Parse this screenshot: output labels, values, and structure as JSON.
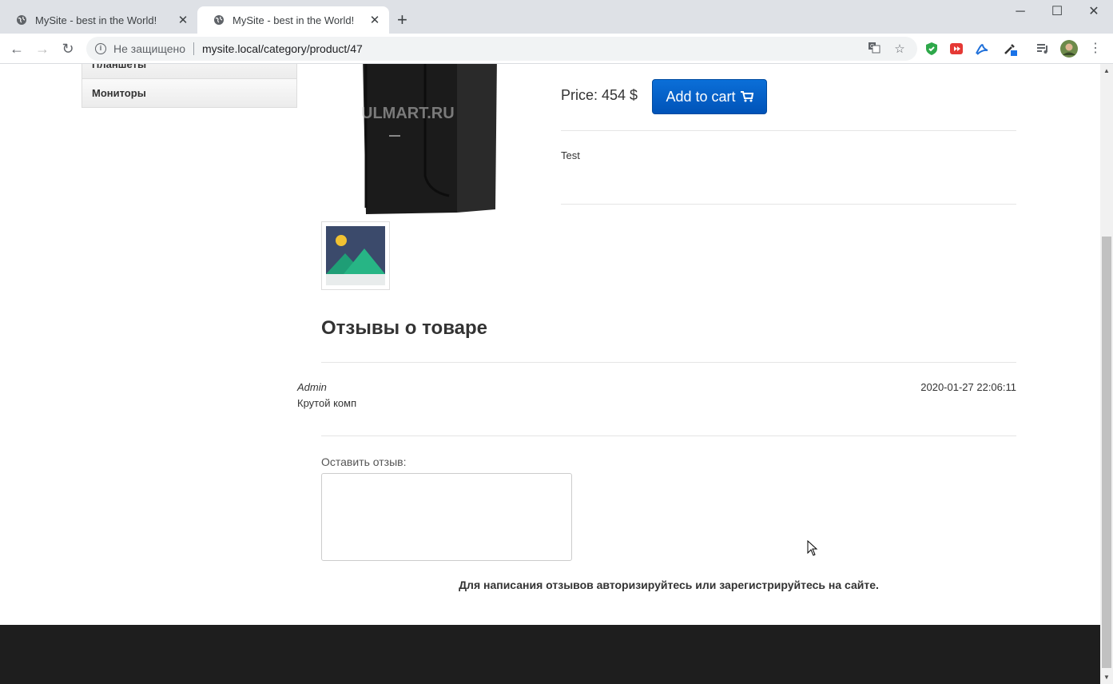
{
  "browser": {
    "tabs": [
      {
        "title": "MySite - best in the World!",
        "close": "✕"
      },
      {
        "title": "MySite - best in the World!",
        "close": "✕"
      }
    ],
    "new_tab": "+",
    "window_controls": {
      "minimize": "─",
      "maximize": "☐",
      "close": "✕"
    },
    "nav": {
      "back": "←",
      "forward": "→",
      "reload": "↻"
    },
    "address": {
      "security_text": "Не защищено",
      "url": "mysite.local/category/product/47"
    },
    "menu": "⋮"
  },
  "sidebar": {
    "items": [
      {
        "label": "Планшеты"
      },
      {
        "label": "Мониторы"
      }
    ]
  },
  "product": {
    "watermark": "ULMART.RU",
    "price": "Price: 454 $",
    "add_to_cart": "Add to cart",
    "description": "Test"
  },
  "reviews": {
    "title": "Отзывы о товаре",
    "items": [
      {
        "author": "Admin",
        "date": "2020-01-27 22:06:11",
        "text": "Крутой комп"
      }
    ],
    "form_label": "Оставить отзыв:",
    "auth_message": "Для написания отзывов авторизируйтесь или зарегистрируйтесь на сайте."
  },
  "colors": {
    "accent": "#0b6fd8",
    "footer": "#1e1e1e"
  }
}
